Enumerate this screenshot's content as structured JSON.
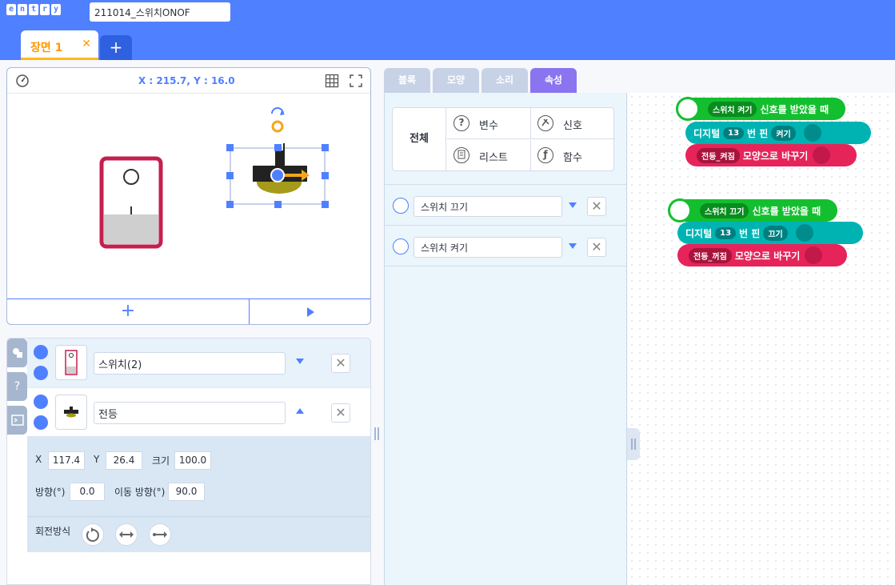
{
  "header": {
    "logo_letters": [
      "e",
      "n",
      "t",
      "r",
      "y"
    ],
    "project_title": "211014_스위치ONOF",
    "scene_tab": "장면 1",
    "scene_close": "✕",
    "scene_add": "+"
  },
  "stage": {
    "coord": "X : 215.7,  Y : 16.0",
    "add_button": "+"
  },
  "objects": [
    {
      "name": "스위치(2)",
      "selected": false
    },
    {
      "name": "전등",
      "selected": true
    }
  ],
  "object_props": {
    "x_label": "X",
    "x_value": "117.4",
    "y_label": "Y",
    "y_value": "26.4",
    "size_label": "크기",
    "size_value": "100.0",
    "direction_label": "방향(°)",
    "direction_value": "0.0",
    "move_dir_label": "이동 방향(°)",
    "move_dir_value": "90.0",
    "rotation_label": "회전방식"
  },
  "side_tabs": [
    "?"
  ],
  "block_tabs": [
    "블록",
    "모양",
    "소리",
    "속성"
  ],
  "active_tab": "속성",
  "categories": {
    "all": "전체",
    "items": [
      {
        "icon": "?",
        "label": "변수"
      },
      {
        "icon": "",
        "label": "신호"
      },
      {
        "icon": "",
        "label": "리스트"
      },
      {
        "icon": "ƒ",
        "label": "함수"
      }
    ]
  },
  "signals": [
    "스위치 끄기",
    "스위치 켜기"
  ],
  "code_blocks": [
    {
      "event_signal": "스위치 켜기",
      "event_text": "신호를 받았을 때",
      "hw_label": "디지털",
      "hw_pin": "13",
      "hw_mid": "번 핀",
      "hw_state": "켜기",
      "looks_shape": "전등_켜짐",
      "looks_text": "모양으로 바꾸기"
    },
    {
      "event_signal": "스위치 끄기",
      "event_text": "신호를 받았을 때",
      "hw_label": "디지털",
      "hw_pin": "13",
      "hw_mid": "번 핀",
      "hw_state": "끄기",
      "looks_shape": "전등_꺼짐",
      "looks_text": "모양으로 바꾸기"
    }
  ],
  "colors": {
    "brand": "#4f80ff",
    "active_tab": "#8a74f0",
    "event": "#13bf2e",
    "hardware": "#00b3b3",
    "looks": "#e6245a",
    "scene_accent": "#ffb81c"
  }
}
